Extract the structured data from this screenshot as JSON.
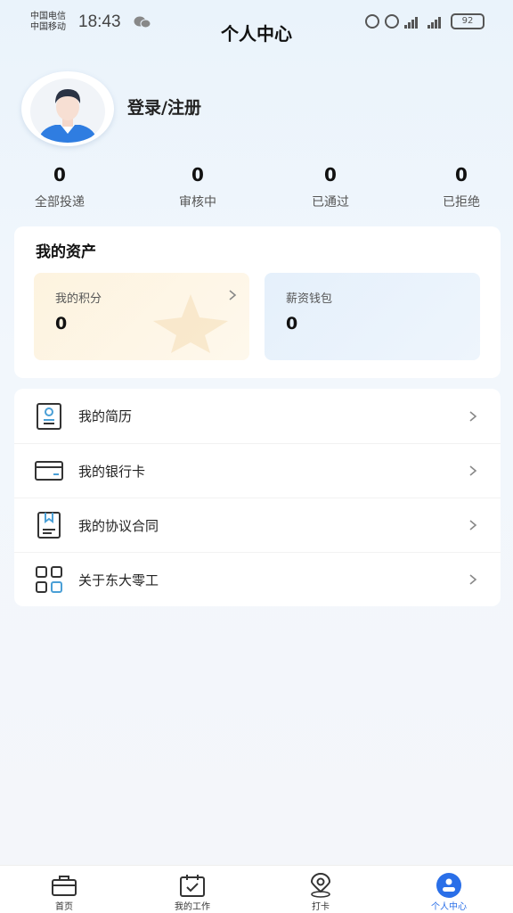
{
  "status_bar": {
    "carrier_1": "中国电信",
    "carrier_2": "中国移动",
    "time": "18:43",
    "battery": "92"
  },
  "header": {
    "title": "个人中心"
  },
  "profile": {
    "login_label": "登录/注册"
  },
  "stats": [
    {
      "value": "0",
      "label": "全部投递"
    },
    {
      "value": "0",
      "label": "审核中"
    },
    {
      "value": "0",
      "label": "已通过"
    },
    {
      "value": "0",
      "label": "已拒绝"
    }
  ],
  "assets": {
    "title": "我的资产",
    "points": {
      "label": "我的积分",
      "value": "0"
    },
    "wallet": {
      "label": "薪资钱包",
      "value": "0"
    }
  },
  "menu": [
    {
      "label": "我的简历",
      "icon": "resume-icon"
    },
    {
      "label": "我的银行卡",
      "icon": "bank-card-icon"
    },
    {
      "label": "我的协议合同",
      "icon": "contract-icon"
    },
    {
      "label": "关于东大零工",
      "icon": "grid-apps-icon"
    }
  ],
  "tabs": [
    {
      "label": "首页",
      "icon": "briefcase-icon"
    },
    {
      "label": "我的工作",
      "icon": "calendar-check-icon"
    },
    {
      "label": "打卡",
      "icon": "location-pin-icon"
    },
    {
      "label": "个人中心",
      "icon": "profile-icon",
      "active": true
    }
  ],
  "colors": {
    "accent": "#2a6fe8",
    "points_bg": "#fdf3df",
    "wallet_bg": "#e5f0fb"
  }
}
